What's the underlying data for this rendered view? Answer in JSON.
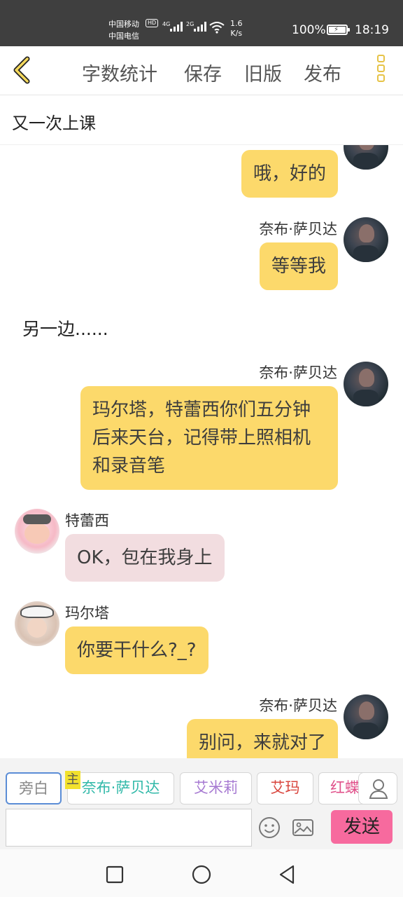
{
  "status_bar": {
    "carrier_1": "中国移动",
    "carrier_2": "中国电信",
    "hd_badge": "HD",
    "net_1": "4G",
    "net_2": "2G",
    "speed_value": "1.6",
    "speed_unit": "K/s",
    "battery": "100%",
    "time": "18:19"
  },
  "toolbar": {
    "back_icon": "chevron-left-icon",
    "word_count": "字数统计",
    "save": "保存",
    "old_version": "旧版",
    "publish": "发布",
    "more_icon": "more-vertical-icon"
  },
  "story": {
    "title": "又一次上课"
  },
  "messages": [
    {
      "side": "right",
      "name": "",
      "text": "哦，好的",
      "color": "#fcd96b"
    },
    {
      "side": "right",
      "name": "奈布·萨贝达",
      "text": "等等我",
      "color": "#fcd96b"
    },
    {
      "side": "narration",
      "text": "另一边......"
    },
    {
      "side": "right",
      "name": "奈布·萨贝达",
      "text": "玛尔塔，特蕾西你们五分钟后来天台，记得带上照相机和录音笔",
      "color": "#fcd96b"
    },
    {
      "side": "left",
      "name": "特蕾西",
      "text": "OK，包在我身上",
      "color": "#f2dde0"
    },
    {
      "side": "left",
      "name": "玛尔塔",
      "text": "你要干什么?_?",
      "color": "#fcd96b"
    },
    {
      "side": "right",
      "name": "奈布·萨贝达",
      "text": "别问，来就对了",
      "color": "#fcd96b"
    }
  ],
  "role_chips": {
    "narrator": "旁白",
    "master_tag": "主",
    "chip_1": "奈布·萨贝达",
    "chip_2": "艾米莉",
    "chip_3": "艾玛",
    "chip_4": "红蝶",
    "chip_colors": [
      "#2fb8a8",
      "#a77ad2",
      "#d9463e",
      "#e0508a"
    ],
    "user_icon": "user-icon"
  },
  "composer": {
    "placeholder": "",
    "emoji_icon": "emoji-icon",
    "image_icon": "image-icon",
    "send": "发送"
  },
  "nav_bar": {
    "recent_icon": "square-icon",
    "home_icon": "circle-icon",
    "back_icon": "triangle-back-icon"
  }
}
